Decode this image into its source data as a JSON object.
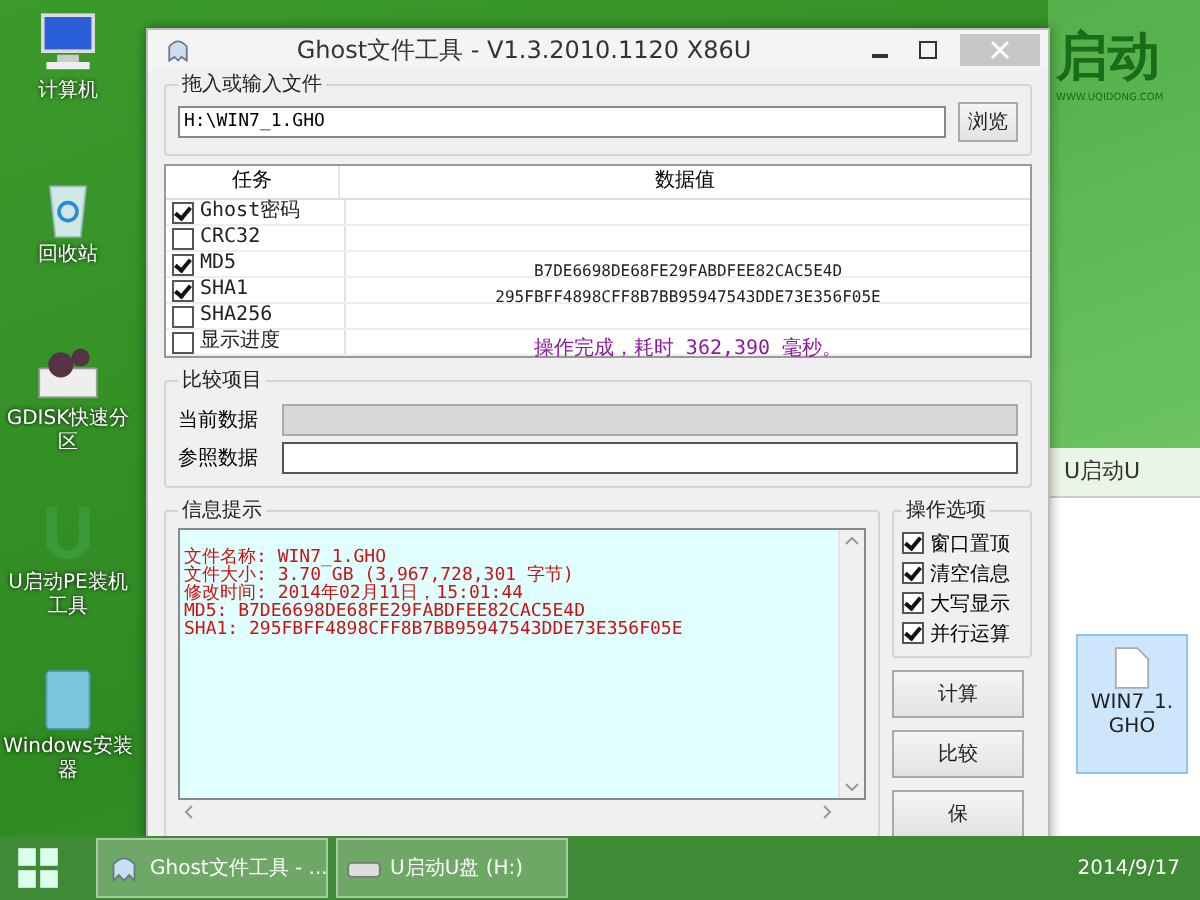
{
  "desktop_icons": [
    {
      "label": "计算机",
      "kind": "computer"
    },
    {
      "label": "回收站",
      "kind": "bin"
    },
    {
      "label": "GDISK快速分区",
      "kind": "disk"
    },
    {
      "label": "U启动PE装机工具",
      "kind": "u"
    },
    {
      "label": "Windows安装器",
      "kind": "installer"
    }
  ],
  "background_app": {
    "logo": "启动",
    "site": "WWW.UQIDONG.COM",
    "tab": "U启动U",
    "file": "WIN7_1.GHO"
  },
  "window": {
    "title": "Ghost文件工具 - V1.3.2010.1120 X86U",
    "file_group": {
      "title": "拖入或输入文件",
      "path": "H:\\WIN7_1.GHO",
      "browse": "浏览"
    },
    "table": {
      "columns": [
        "任务",
        "数据值"
      ],
      "rows": [
        {
          "task": "Ghost密码",
          "checked": true
        },
        {
          "task": "CRC32",
          "checked": false
        },
        {
          "task": "MD5",
          "checked": true,
          "kind": "hash",
          "value": "B7DE6698DE68FE29FABDFEE82CAC5E4D"
        },
        {
          "task": "SHA1",
          "checked": true,
          "kind": "hash",
          "value": "295FBFF4898CFF8B7BB95947543DDE73E356F05E"
        },
        {
          "task": "SHA256",
          "checked": false
        },
        {
          "task": "显示进度",
          "checked": false,
          "kind": "status",
          "value": "操作完成，耗时 362,390 毫秒。"
        }
      ]
    },
    "compare": {
      "title": "比较项目",
      "fields": [
        {
          "label": "当前数据",
          "disabled": true
        },
        {
          "label": "参照数据",
          "disabled": false
        }
      ]
    },
    "info": {
      "title": "信息提示",
      "lines": [
        "文件名称: WIN7_1.GHO",
        "文件大小: 3.70 GB (3,967,728,301 字节)",
        "修改时间: 2014年02月11日，15:01:44",
        "MD5: B7DE6698DE68FE29FABDFEE82CAC5E4D",
        "SHA1: 295FBFF4898CFF8B7BB95947543DDE73E356F05E"
      ]
    },
    "options": {
      "title": "操作选项",
      "items": [
        {
          "label": "窗口置顶",
          "checked": true
        },
        {
          "label": "清空信息",
          "checked": true
        },
        {
          "label": "大写显示",
          "checked": true
        },
        {
          "label": "并行运算",
          "checked": true
        }
      ]
    },
    "buttons": [
      "计算",
      "比较",
      "保"
    ]
  },
  "taskbar": {
    "tasks": [
      "Ghost文件工具 - ...",
      "U启动U盘 (H:)"
    ],
    "date": "2014/9/17"
  }
}
